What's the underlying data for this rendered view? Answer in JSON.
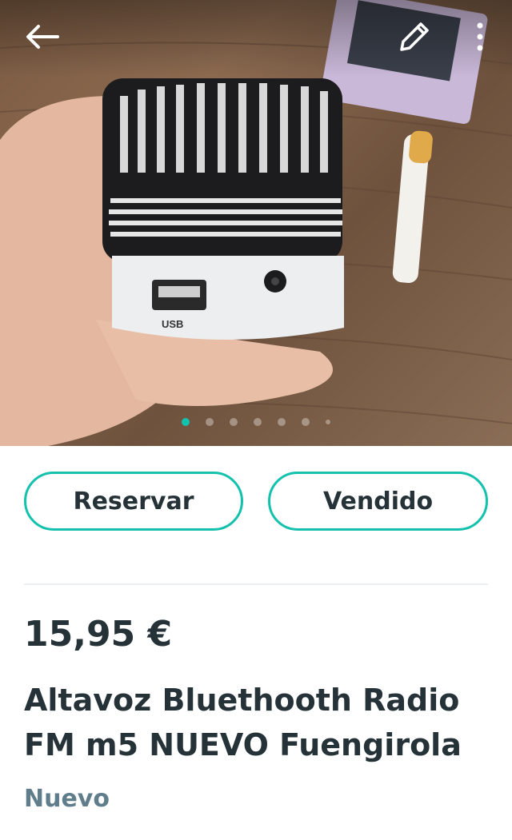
{
  "header": {
    "back_icon": "arrow-left-icon",
    "edit_icon": "pencil-icon",
    "more_icon": "more-vertical-icon"
  },
  "gallery": {
    "image": "bluetooth-speaker-photo",
    "labels": {
      "usb": "USB"
    },
    "page_count": 7,
    "active_index": 0
  },
  "actions": {
    "reserve_label": "Reservar",
    "sold_label": "Vendido",
    "accent_color": "#13c1ac"
  },
  "item": {
    "price": "15,95 €",
    "title": "Altavoz Bluethooth Radio FM m5 NUEVO Fuengirola",
    "condition": "Nuevo"
  }
}
